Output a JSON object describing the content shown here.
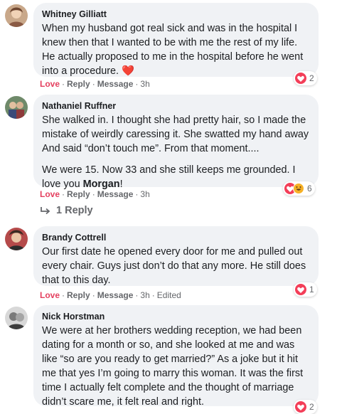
{
  "comments": [
    {
      "name": "Whitney Gilliatt",
      "text": "When my husband got real sick and was in the hospital I knew then that I wanted to be with me the rest of my life. He actually proposed to me in the hospital before he went into a procedure. ❤️",
      "actions": {
        "love": "Love",
        "reply": "Reply",
        "message": "Message",
        "time": "3h"
      },
      "reaction_count": "2"
    },
    {
      "name": "Nathaniel Ruffner",
      "text_p1": "She walked in. I thought she had pretty hair, so I made the mistake of weirdly caressing it. She swatted my hand away And said “don’t touch me”. From that moment....",
      "text_p2_before": "We were 15. Now 33 and she still keeps me grounded. I love you ",
      "mention": "Morgan",
      "text_p2_after": "!",
      "actions": {
        "love": "Love",
        "reply": "Reply",
        "message": "Message",
        "time": "3h"
      },
      "reaction_count": "6"
    },
    {
      "name": "Brandy Cottrell",
      "text": "Our first date he opened every door for me and pulled out every chair. Guys just don’t do that any more. He still does that to this day.",
      "actions": {
        "love": "Love",
        "reply": "Reply",
        "message": "Message",
        "time": "3h",
        "edited": "Edited"
      },
      "reaction_count": "1"
    },
    {
      "name": "Nick Horstman",
      "text": "We were at her brothers wedding reception, we had been dating for a month or so, and she looked at me and was like “so are you ready to get married?” As a joke but it hit me that yes I’m going to marry this woman. It was the first time I actually felt complete and the thought of marriage didn’t scare me, it felt real and right.",
      "reaction_count": "2"
    }
  ],
  "replies": {
    "label": "1 Reply",
    "icon": "reply-arrow-icon"
  },
  "colors": {
    "love": "#e4405f",
    "bubble": "#f0f2f5",
    "meta": "#65676b",
    "heart": "#f33e58",
    "haha": "#f7b125"
  }
}
